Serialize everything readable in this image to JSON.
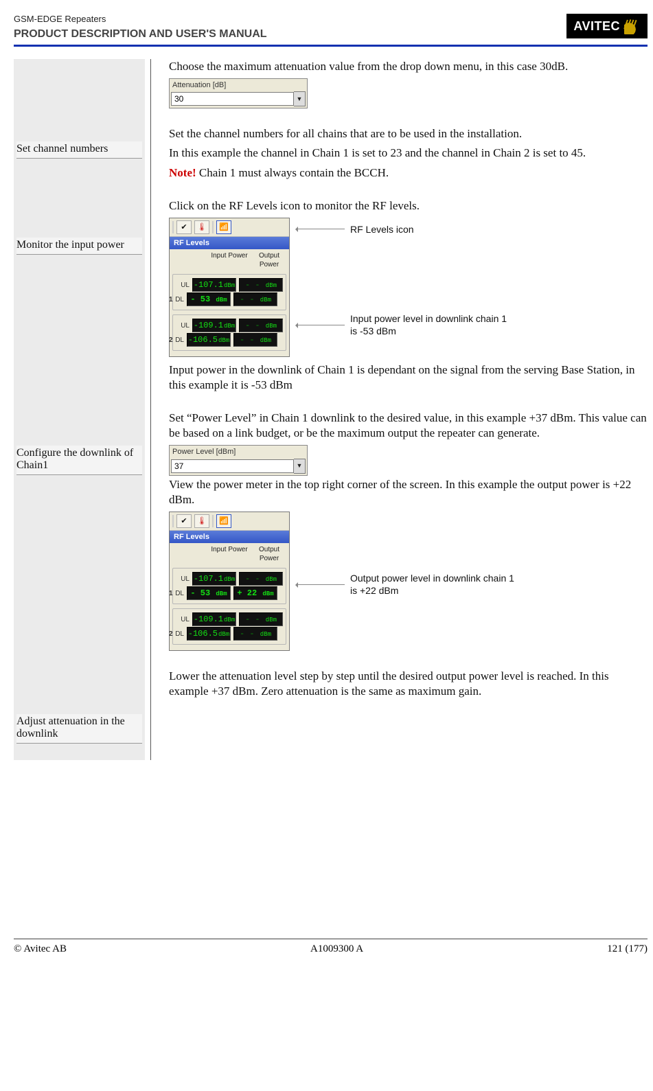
{
  "header": {
    "doc_type": "GSM-EDGE Repeaters",
    "manual_title": "PRODUCT DESCRIPTION AND USER'S MANUAL",
    "logo_text": "AVITEC"
  },
  "sidebar": {
    "set_channel": "Set channel numbers",
    "monitor_input": "Monitor the input power",
    "configure_dl": "Configure the downlink of Chain1",
    "adjust_attn": "Adjust attenuation in the downlink"
  },
  "sec_attn": {
    "intro": "Choose the maximum attenuation value from the drop down menu, in this case 30dB.",
    "attn_label": "Attenuation [dB]",
    "attn_value": "30"
  },
  "sec_channel": {
    "p1": "Set the channel numbers for all chains that are to be used in the installation.",
    "p2": "In this example the channel in Chain 1 is set to 23 and the channel in Chain 2 is set to 45.",
    "note_prefix": "Note!",
    "note_text": " Chain 1 must always contain the BCCH."
  },
  "sec_monitor": {
    "intro": "Click on the RF Levels icon to monitor the RF levels.",
    "callout_icon": "RF Levels icon",
    "callout_input": "Input power level in downlink chain 1 is -53 dBm",
    "post": "Input power in the downlink of Chain 1 is dependant on the signal from the serving Base Station, in this example it is -53 dBm"
  },
  "sec_configure": {
    "p1": "Set “Power Level” in Chain 1 downlink to the desired value, in this example +37 dBm. This value can be based on a link budget, or be the maximum output the repeater can generate.",
    "plabel": "Power Level [dBm]",
    "pvalue": "37",
    "p2": "View the power meter in the top right corner of the screen. In this example the output power is +22 dBm.",
    "callout_output": "Output power level in downlink chain 1 is +22 dBm"
  },
  "sec_adjust": {
    "p1": "Lower the attenuation level step by step until the desired output power level is reached. In this example +37 dBm. Zero attenuation is the same as maximum gain."
  },
  "rf": {
    "title": "RF Levels",
    "col_in": "Input Power",
    "col_out": "Output Power",
    "ul": "UL",
    "dl": "DL",
    "unit": "dBm",
    "row1_ul_in": "-107.1",
    "row1_dl_in": "- 53",
    "row2_ul_in": "-109.1",
    "row2_dl_in": "-106.5",
    "dashes": "- -",
    "out_22": "+ 22"
  },
  "footer": {
    "left": "© Avitec AB",
    "center": "A1009300 A",
    "right": "121 (177)"
  }
}
